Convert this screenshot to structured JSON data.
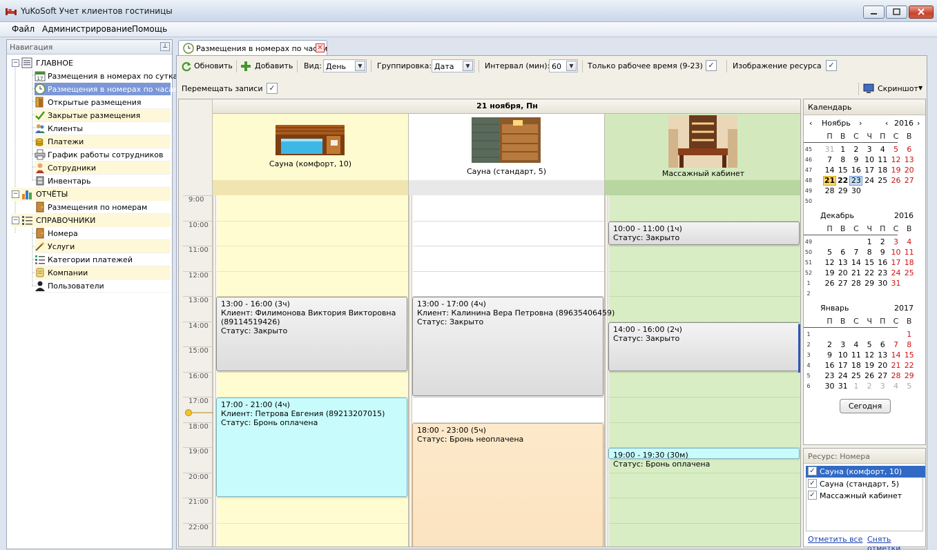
{
  "window": {
    "title": "YuKoSoft Учет клиентов гостиницы"
  },
  "menu": [
    "Файл",
    "Администрирование",
    "Помощь"
  ],
  "nav": {
    "title": "Навигация",
    "groups": [
      {
        "label": "ГЛАВНОЕ",
        "items": [
          "Размещения в номерах по суткам",
          "Размещения в номерах по часам",
          "Открытые размещения",
          "Закрытые размещения",
          "Клиенты",
          "Платежи",
          "График работы сотрудников",
          "Сотрудники",
          "Инвентарь"
        ]
      },
      {
        "label": "ОТЧЁТЫ",
        "items": [
          "Размещения по номерам"
        ]
      },
      {
        "label": "СПРАВОЧНИКИ",
        "items": [
          "Номера",
          "Услуги",
          "Категории платежей",
          "Компании",
          "Пользователи"
        ]
      }
    ]
  },
  "tab": {
    "label": "Размещения в номерах по часам"
  },
  "toolbar": {
    "refresh": "Обновить",
    "add": "Добавить",
    "view_label": "Вид:",
    "view_value": "День",
    "group_label": "Группировка:",
    "group_value": "Дата",
    "interval_label": "Интервал (мин):",
    "interval_value": "60",
    "worktime_label": "Только рабочее время (9-23)",
    "resource_image_label": "Изображение ресурса",
    "move_label": "Перемещать записи",
    "screenshot": "Скриншот"
  },
  "scheduler": {
    "date_header": "21 ноября, Пн",
    "times": [
      "9:00",
      "10:00",
      "11:00",
      "12:00",
      "13:00",
      "14:00",
      "15:00",
      "16:00",
      "17:00",
      "18:00",
      "19:00",
      "20:00",
      "21:00",
      "22:00"
    ],
    "resources": [
      "Сауна (комфорт, 10)",
      "Сауна (стандарт, 5)",
      "Массажный кабинет"
    ],
    "appointments": [
      {
        "res": 0,
        "start": 13,
        "end": 16,
        "style": "gray",
        "lines": [
          "13:00 - 16:00 (3ч)",
          "Клиент: Филимонова Виктория Викторовна",
          "(89114519426)",
          "Статус: Закрыто"
        ]
      },
      {
        "res": 0,
        "start": 17,
        "end": 21,
        "style": "cyan",
        "lines": [
          "17:00 - 21:00 (4ч)",
          "Клиент: Петрова Евгения (89213207015)",
          "Статус: Бронь оплачена"
        ]
      },
      {
        "res": 1,
        "start": 13,
        "end": 17,
        "style": "gray",
        "lines": [
          "13:00 - 17:00 (4ч)",
          "Клиент: Калинина Вера Петровна (89635406459)",
          "Статус: Закрыто"
        ]
      },
      {
        "res": 1,
        "start": 18,
        "end": 23,
        "style": "peach",
        "lines": [
          "18:00 - 23:00 (5ч)",
          "Статус: Бронь неоплачена"
        ]
      },
      {
        "res": 2,
        "start": 10,
        "end": 11,
        "style": "gray",
        "lines": [
          "10:00 - 11:00 (1ч)",
          "Статус: Закрыто"
        ]
      },
      {
        "res": 2,
        "start": 14,
        "end": 16,
        "style": "gray",
        "lines": [
          "14:00 - 16:00 (2ч)",
          "Статус: Закрыто"
        ]
      },
      {
        "res": 2,
        "start": 19,
        "end": 19.5,
        "style": "cyan",
        "lines": [
          "19:00 - 19:30 (30м)",
          "Статус: Бронь оплачена"
        ]
      }
    ]
  },
  "calendar": {
    "title": "Календарь",
    "day_headers": [
      "П",
      "В",
      "С",
      "Ч",
      "П",
      "С",
      "В"
    ],
    "months": [
      {
        "name": "Ноябрь",
        "year": "2016",
        "weeks": [
          {
            "n": "45",
            "days": [
              "31",
              "1",
              "2",
              "3",
              "4",
              "5",
              "6"
            ]
          },
          {
            "n": "46",
            "days": [
              "7",
              "8",
              "9",
              "10",
              "11",
              "12",
              "13"
            ]
          },
          {
            "n": "47",
            "days": [
              "14",
              "15",
              "16",
              "17",
              "18",
              "19",
              "20"
            ]
          },
          {
            "n": "48",
            "days": [
              "21",
              "22",
              "23",
              "24",
              "25",
              "26",
              "27"
            ]
          },
          {
            "n": "49",
            "days": [
              "28",
              "29",
              "30",
              "",
              "",
              "",
              ""
            ]
          },
          {
            "n": "50",
            "days": [
              "",
              "",
              "",
              "",
              "",
              "",
              ""
            ]
          }
        ]
      },
      {
        "name": "Декабрь",
        "year": "2016",
        "weeks": [
          {
            "n": "49",
            "days": [
              "",
              "",
              "",
              "1",
              "2",
              "3",
              "4"
            ]
          },
          {
            "n": "50",
            "days": [
              "5",
              "6",
              "7",
              "8",
              "9",
              "10",
              "11"
            ]
          },
          {
            "n": "51",
            "days": [
              "12",
              "13",
              "14",
              "15",
              "16",
              "17",
              "18"
            ]
          },
          {
            "n": "52",
            "days": [
              "19",
              "20",
              "21",
              "22",
              "23",
              "24",
              "25"
            ]
          },
          {
            "n": "1",
            "days": [
              "26",
              "27",
              "28",
              "29",
              "30",
              "31",
              ""
            ]
          },
          {
            "n": "2",
            "days": [
              "",
              "",
              "",
              "",
              "",
              "",
              ""
            ]
          }
        ]
      },
      {
        "name": "Январь",
        "year": "2017",
        "weeks": [
          {
            "n": "1",
            "days": [
              "",
              "",
              "",
              "",
              "",
              "",
              "1"
            ]
          },
          {
            "n": "2",
            "days": [
              "2",
              "3",
              "4",
              "5",
              "6",
              "7",
              "8"
            ]
          },
          {
            "n": "3",
            "days": [
              "9",
              "10",
              "11",
              "12",
              "13",
              "14",
              "15"
            ]
          },
          {
            "n": "4",
            "days": [
              "16",
              "17",
              "18",
              "19",
              "20",
              "21",
              "22"
            ]
          },
          {
            "n": "5",
            "days": [
              "23",
              "24",
              "25",
              "26",
              "27",
              "28",
              "29"
            ]
          },
          {
            "n": "6",
            "days": [
              "30",
              "31",
              "1",
              "2",
              "3",
              "4",
              "5"
            ]
          }
        ]
      }
    ],
    "today_button": "Сегодня"
  },
  "resource_panel": {
    "title": "Ресурс: Номера",
    "items": [
      "Сауна (комфорт, 10)",
      "Сауна (стандарт, 5)",
      "Массажный кабинет"
    ],
    "check_all": "Отметить все",
    "uncheck_all": "Снять отметки"
  },
  "colors": {
    "col_comfort": "#fffcd2",
    "col_standard": "#ffffff",
    "col_massage": "#d8edc4",
    "selection": "#7b97d6"
  }
}
